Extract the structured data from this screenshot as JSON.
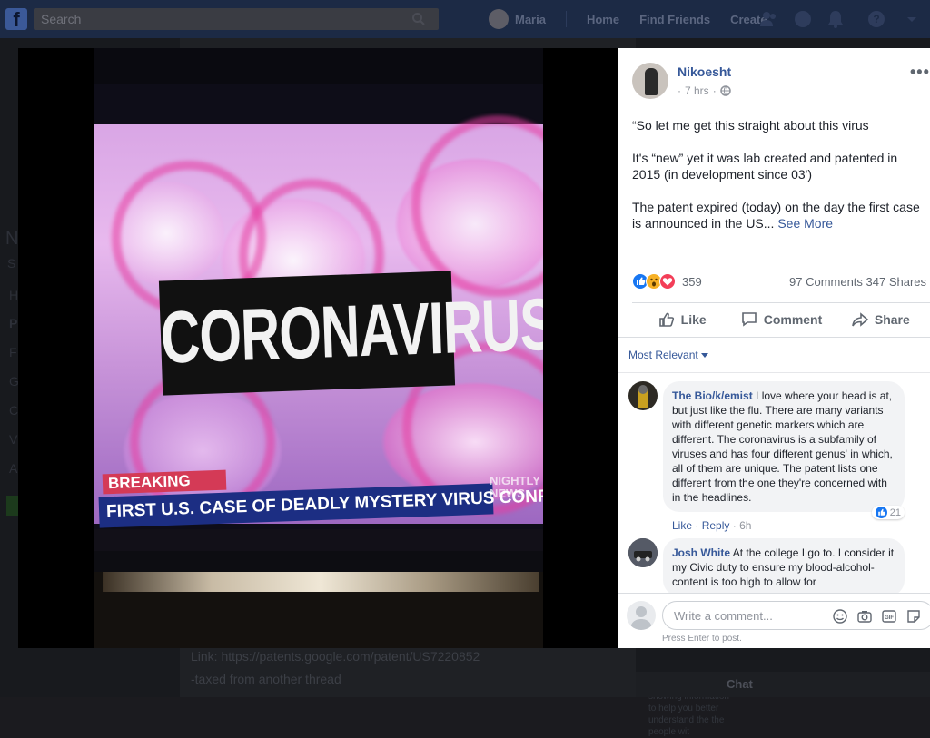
{
  "topbar": {
    "search_placeholder": "Search",
    "user_name": "Maria",
    "nav": [
      "Home",
      "Find Friends",
      "Create"
    ]
  },
  "background": {
    "link_text": "Link: https://patents.google.com/patent/US7220852",
    "tag_text": "-taxed from another thread",
    "side_note": "Facebook is showing information to help you better understand the the people wit",
    "chat_label": "Chat",
    "left_letters": [
      "N",
      "S",
      "H",
      "P",
      "F",
      "G",
      "C",
      "V",
      "A"
    ]
  },
  "photo": {
    "headline": "CORONAVIRUS",
    "breaking": "BREAKING NEWS",
    "crawl": "FIRST U.S. CASE OF DEADLY MYSTERY VIRUS CONFIRMED",
    "network_line1": "NIGHTLY",
    "network_line2": "NEWS"
  },
  "post": {
    "author": "Nikoesht",
    "time": "7 hrs",
    "paragraphs": [
      "“So let me get this straight about this virus",
      "It's “new” yet it was lab created and patented in 2015 (in development since 03')",
      "The patent expired (today) on the day the first case is announced in the US..."
    ],
    "see_more": "See More",
    "reaction_count": "359",
    "comments_count": "97 Comments",
    "shares_count": "347 Shares",
    "actions": {
      "like": "Like",
      "comment": "Comment",
      "share": "Share"
    },
    "sort_label": "Most Relevant"
  },
  "comments": [
    {
      "name": "The Bio/k/emist",
      "text": "I love where your head is at, but just like the flu. There are many variants with different genetic markers which are different. The coronavirus is a subfamily of viruses and has four different genus' in which, all of them are unique. The patent lists one different from the one they're concerned with in the headlines.",
      "like": "Like",
      "reply": "Reply",
      "time": "6h",
      "likes": "21"
    },
    {
      "name": "Josh White",
      "text": "At the college I go to. I consider it my Civic duty to ensure my blood-alcohol-content is too high to allow for"
    }
  ],
  "composer": {
    "placeholder": "Write a comment...",
    "hint": "Press Enter to post."
  },
  "colors": {
    "topbar": "#1c2a45",
    "link": "#365899",
    "like_blue": "#1877f2",
    "love_red": "#f33e58"
  }
}
